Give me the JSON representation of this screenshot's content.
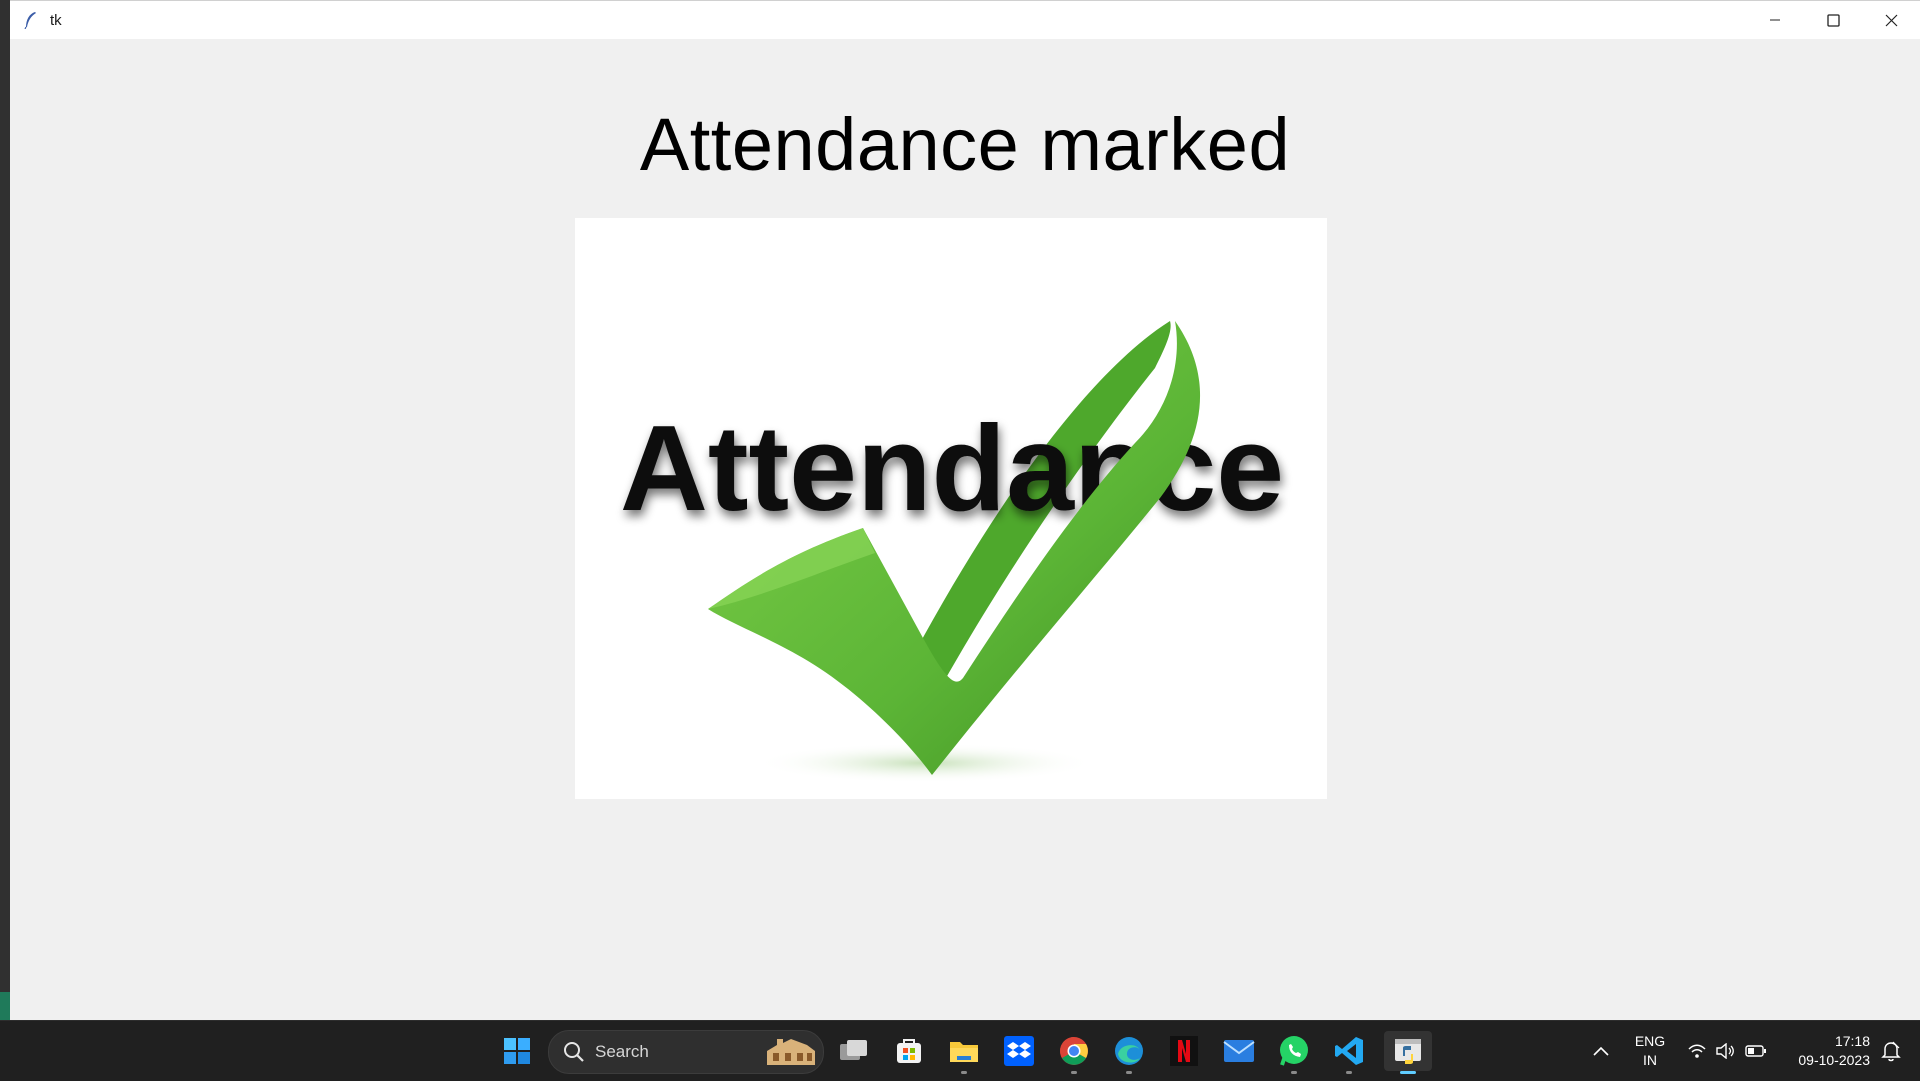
{
  "window": {
    "title": "tk",
    "controls": [
      "minimize-icon",
      "maximize-icon",
      "close-icon"
    ]
  },
  "content": {
    "heading": "Attendance marked",
    "image": {
      "word": "Attendance",
      "check_color": "#6abf3e"
    }
  },
  "taskbar": {
    "search_placeholder": "Search",
    "apps": [
      "start-icon",
      "task-view-icon",
      "microsoft-store-icon",
      "file-explorer-icon",
      "dropbox-icon",
      "chrome-icon",
      "edge-icon",
      "netflix-icon",
      "mail-icon",
      "whatsapp-icon",
      "vscode-icon",
      "python-icon"
    ],
    "tray": {
      "language_line1": "ENG",
      "language_line2": "IN",
      "time": "17:18",
      "date": "09-10-2023"
    }
  },
  "colors": {
    "window_bg": "#f0f0f0",
    "taskbar_bg": "#202020",
    "accent": "#60cdff"
  }
}
